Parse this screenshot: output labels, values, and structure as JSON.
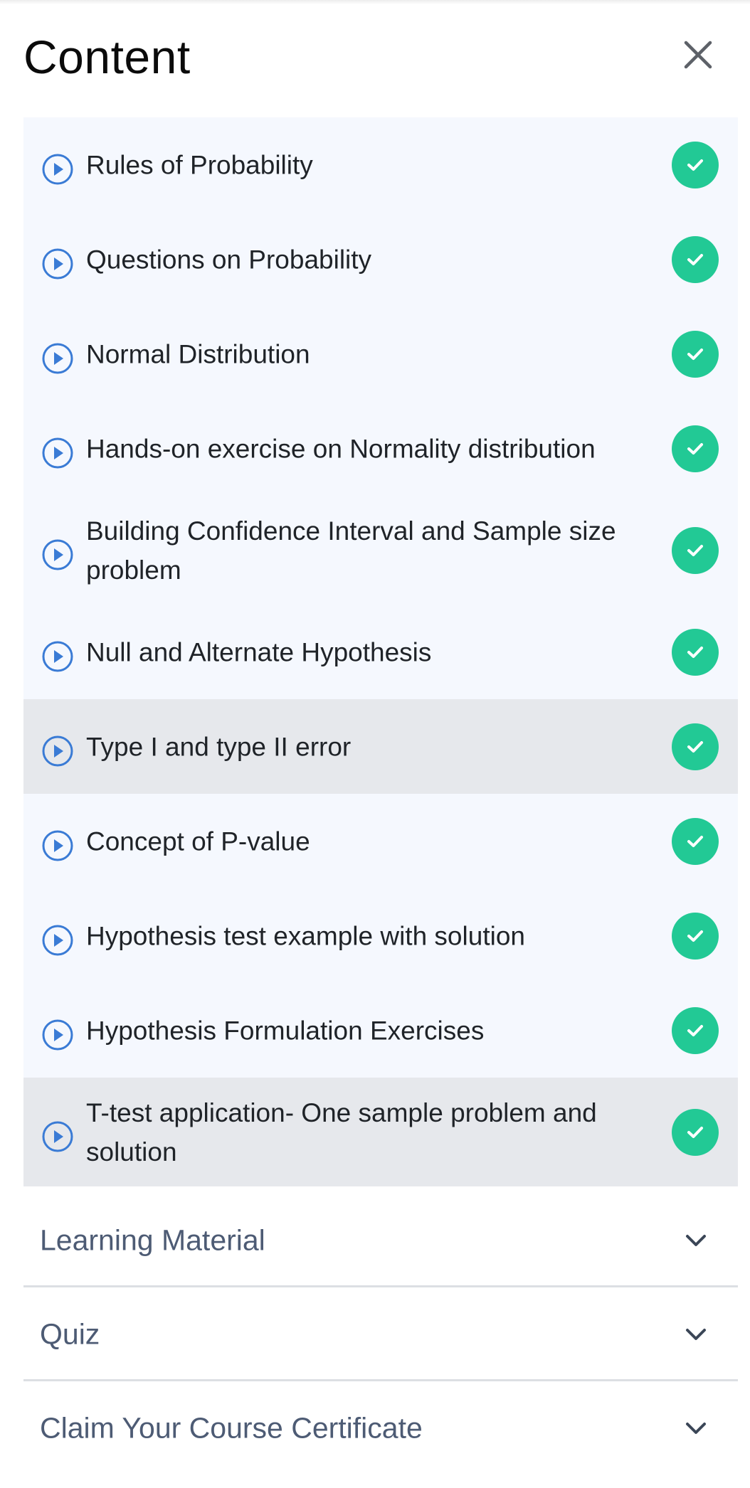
{
  "header": {
    "title": "Content"
  },
  "lessons": [
    {
      "label": "Rules of Probability",
      "completed": true
    },
    {
      "label": "Questions on Probability",
      "completed": true
    },
    {
      "label": "Normal Distribution",
      "completed": true
    },
    {
      "label": "Hands-on exercise on Normality distribution",
      "completed": true
    },
    {
      "label": "Building Confidence Interval and Sample size problem",
      "completed": true
    },
    {
      "label": "Null and Alternate Hypothesis",
      "completed": true
    },
    {
      "label": "Type I and type II error",
      "completed": true,
      "highlighted": true
    },
    {
      "label": "Concept of P-value",
      "completed": true
    },
    {
      "label": "Hypothesis test example with solution",
      "completed": true
    },
    {
      "label": "Hypothesis Formulation Exercises",
      "completed": true
    },
    {
      "label": "T-test application- One sample problem and solution",
      "completed": true,
      "highlighted": true
    }
  ],
  "sections": [
    {
      "label": "Learning Material"
    },
    {
      "label": "Quiz"
    },
    {
      "label": "Claim Your Course Certificate"
    }
  ],
  "colors": {
    "check": "#22c995",
    "play": "#3a7bd5",
    "list_bg": "#f5f8fe",
    "highlight_bg": "#e6e8ec",
    "section_text": "#4d5b74"
  },
  "icons": {
    "close": "close-icon",
    "play": "play-circle-icon",
    "check": "check-circle-icon",
    "chevron": "chevron-down-icon"
  }
}
